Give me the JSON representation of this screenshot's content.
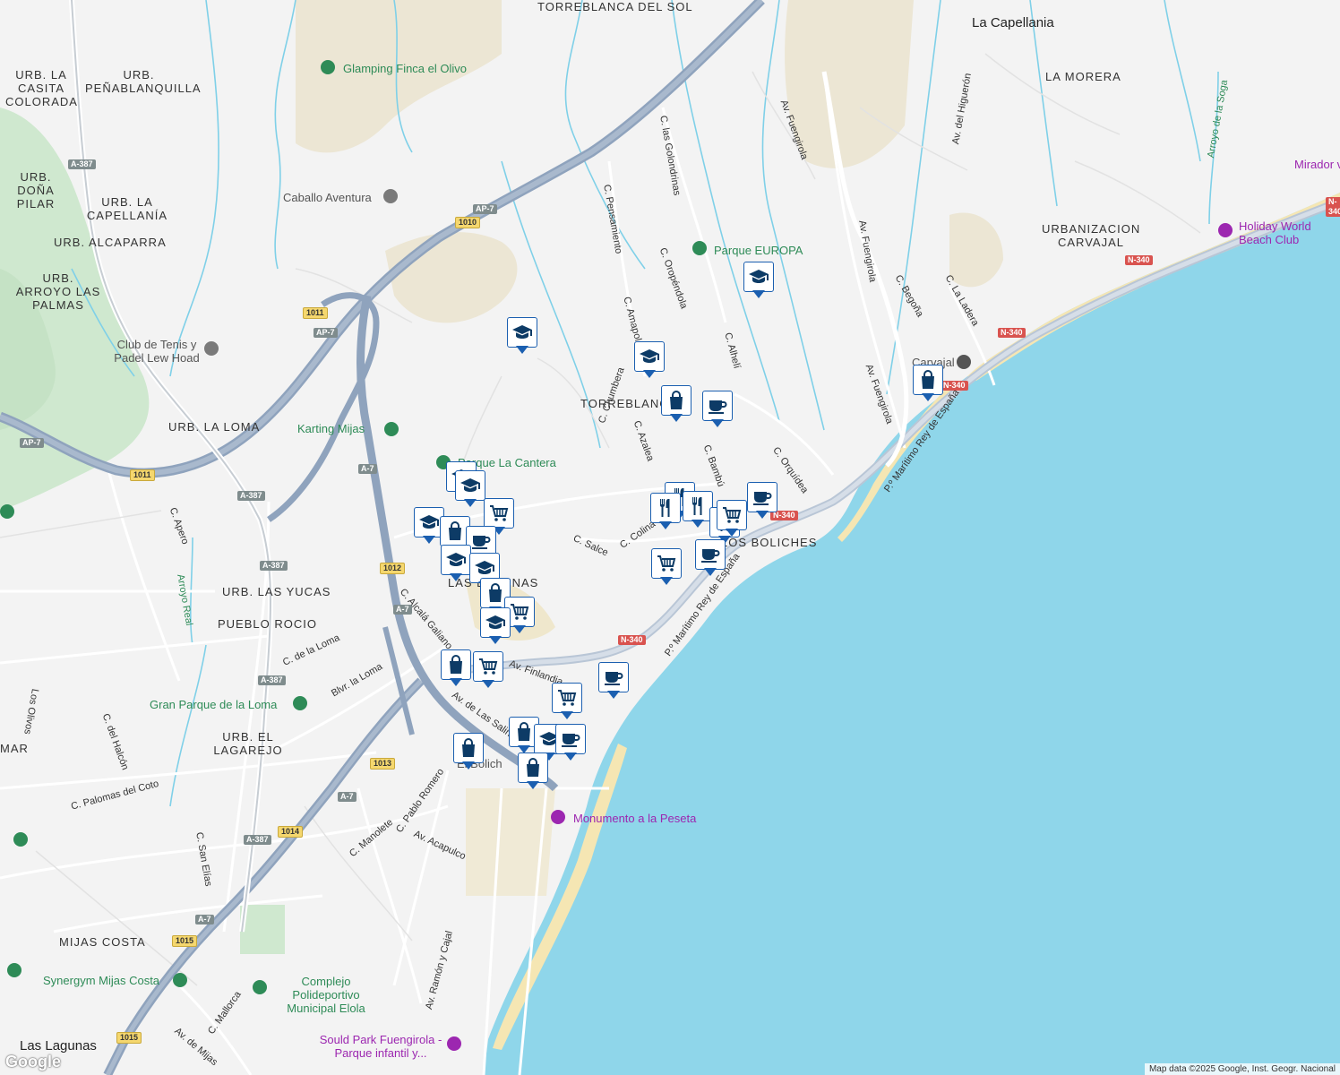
{
  "map": {
    "attribution": "Map data ©2025 Google, Inst. Geogr. Nacional",
    "logo": "Google",
    "colors": {
      "sea": "#8fd6ea",
      "land": "#f3f3f3",
      "park": "#cfe8cf",
      "river": "#7fd0e8",
      "highway": "#8fa3bd",
      "marker_border": "#1b5fb0",
      "marker_icon": "#0d3b66"
    }
  },
  "areas": [
    "TORREBLANCA DEL SOL",
    "La Capellania",
    "LA MORERA",
    "URB. LA CASITA COLORADA",
    "URB. PEÑABLANQUILLA",
    "URB. DOÑA PILAR",
    "URB. LA CAPELLANÍA",
    "URB. ALCAPARRA",
    "URB. ARROYO LAS PALMAS",
    "URB. LA LOMA",
    "URBANIZACION CARVAJAL",
    "TORREBLANCA",
    "URB. LAS YUCAS",
    "PUEBLO ROCIO",
    "URB. EL LAGAREJO",
    "MIJAS COSTA",
    "Las Lagunas",
    "LOS BOLICHES",
    "LAS LAGUNAS"
  ],
  "pois": [
    "Glamping Finca el Olivo",
    "Caballo Aventura",
    "Parque EUROPA",
    "Club de Tenis y Padel Lew Hoad",
    "Karting Mijas",
    "Parque La Cantera",
    "Gran Parque de la Loma",
    "Holiday World Beach Club",
    "Mirador vie",
    "Carvajal",
    "Monumento a la Peseta",
    "Synergym Mijas Costa",
    "Complejo Polideportivo Municipal Elola",
    "Sould Park Fuengirola - Parque infantil y...",
    "El Bolich"
  ],
  "streets": [
    "Av. Fuengirola",
    "C. las Golondrinas",
    "C. Pensamiento",
    "C. Oropéndola",
    "C. Amapolas",
    "C. Alhelí",
    "C. Azalea",
    "C. Bambú",
    "C. Orquídea",
    "C. Chumbera",
    "C. Salce",
    "C. Colina Blanca",
    "Av. del Higuerón",
    "C. Begoña",
    "C. La Ladera",
    "Arroyo de la Soga",
    "P.º Marítimo Rey de España",
    "C. Alcalá Galiano",
    "Av. Finlandia",
    "Av. de Las Salinas",
    "C. de la Loma",
    "Blvr. la Loma",
    "C. del Halcón",
    "Los Olivos",
    "C. Palomas del Coto",
    "C. Apero",
    "Arroyo Real",
    "C. San Elías",
    "C. Manolete",
    "C. Pablo Romero",
    "Av. Acapulco",
    "Av. Ramón y Cajal",
    "C. Mallorca",
    "Av. de Mijas",
    "MAR"
  ],
  "road_shields": [
    "AP-7",
    "1010",
    "1011",
    "A-387",
    "A-7",
    "1012",
    "1013",
    "1014",
    "1015",
    "N-340"
  ],
  "markers": [
    {
      "type": "school-icon"
    },
    {
      "type": "school-icon"
    },
    {
      "type": "school-icon"
    },
    {
      "type": "shopping-bag-icon"
    },
    {
      "type": "cafe-icon"
    },
    {
      "type": "shopping-bag-icon"
    },
    {
      "type": "school-icon"
    },
    {
      "type": "school-icon"
    },
    {
      "type": "grocery-cart-icon"
    },
    {
      "type": "school-icon"
    },
    {
      "type": "shopping-bag-icon"
    },
    {
      "type": "cafe-icon"
    },
    {
      "type": "school-icon"
    },
    {
      "type": "school-icon"
    },
    {
      "type": "shopping-bag-icon"
    },
    {
      "type": "grocery-cart-icon"
    },
    {
      "type": "school-icon"
    },
    {
      "type": "restaurant-icon"
    },
    {
      "type": "restaurant-icon"
    },
    {
      "type": "restaurant-icon"
    },
    {
      "type": "restaurant-icon"
    },
    {
      "type": "cafe-icon"
    },
    {
      "type": "grocery-cart-icon"
    },
    {
      "type": "grocery-cart-icon"
    },
    {
      "type": "cafe-icon"
    },
    {
      "type": "shopping-bag-icon"
    },
    {
      "type": "grocery-cart-icon"
    },
    {
      "type": "cafe-icon"
    },
    {
      "type": "grocery-cart-icon"
    },
    {
      "type": "shopping-bag-icon"
    },
    {
      "type": "school-icon"
    },
    {
      "type": "cafe-icon"
    },
    {
      "type": "shopping-bag-icon"
    },
    {
      "type": "shopping-bag-icon"
    }
  ]
}
